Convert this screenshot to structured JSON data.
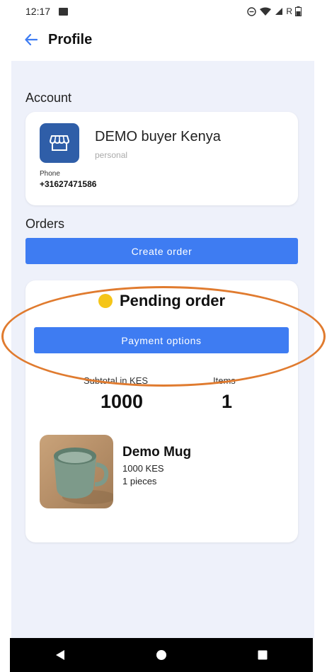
{
  "status_bar": {
    "time": "12:17",
    "network_letter": "R"
  },
  "header": {
    "title": "Profile"
  },
  "account": {
    "section_label": "Account",
    "name": "DEMO buyer Kenya",
    "type": "personal",
    "phone_label": "Phone",
    "phone": "+31627471586"
  },
  "orders": {
    "section_label": "Orders",
    "create_label": "Create order",
    "status": "Pending order",
    "status_color": "#f5c518",
    "payment_label": "Payment options",
    "subtotal_label": "Subtotal in KES",
    "subtotal_value": "1000",
    "items_label": "Items",
    "items_value": "1",
    "product": {
      "name": "Demo Mug",
      "price": "1000 KES",
      "quantity": "1 pieces"
    }
  },
  "colors": {
    "accent": "#3e7cf2",
    "shop_icon_bg": "#2f5ea8",
    "annotation": "#e07b2f"
  }
}
